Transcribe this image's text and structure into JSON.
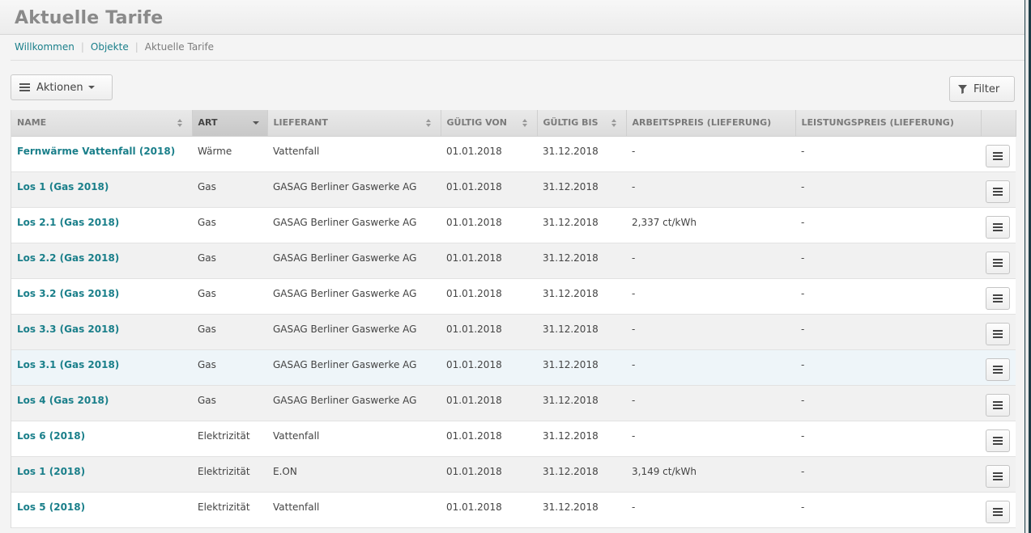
{
  "header": {
    "title": "Aktuelle Tarife"
  },
  "breadcrumb": {
    "items": [
      {
        "label": "Willkommen"
      },
      {
        "label": "Objekte"
      },
      {
        "label": "Aktuelle Tarife"
      }
    ]
  },
  "toolbar": {
    "actions_label": "Aktionen",
    "filter_label": "Filter"
  },
  "table": {
    "columns": [
      {
        "label": "NAME"
      },
      {
        "label": "ART"
      },
      {
        "label": "LIEFERANT"
      },
      {
        "label": "GÜLTIG VON"
      },
      {
        "label": "GÜLTIG BIS"
      },
      {
        "label": "ARBEITSPREIS (LIEFERUNG)"
      },
      {
        "label": "LEISTUNGSPREIS (LIEFERUNG)"
      },
      {
        "label": ""
      }
    ],
    "rows": [
      {
        "name": "Fernwärme Vattenfall (2018)",
        "art": "Wärme",
        "lieferant": "Vattenfall",
        "von": "01.01.2018",
        "bis": "31.12.2018",
        "arbeitspreis": "-",
        "leistungspreis": "-"
      },
      {
        "name": "Los 1 (Gas 2018)",
        "art": "Gas",
        "lieferant": "GASAG Berliner Gaswerke AG",
        "von": "01.01.2018",
        "bis": "31.12.2018",
        "arbeitspreis": "-",
        "leistungspreis": "-"
      },
      {
        "name": "Los 2.1 (Gas 2018)",
        "art": "Gas",
        "lieferant": "GASAG Berliner Gaswerke AG",
        "von": "01.01.2018",
        "bis": "31.12.2018",
        "arbeitspreis": "2,337 ct/kWh",
        "leistungspreis": "-"
      },
      {
        "name": "Los 2.2 (Gas 2018)",
        "art": "Gas",
        "lieferant": "GASAG Berliner Gaswerke AG",
        "von": "01.01.2018",
        "bis": "31.12.2018",
        "arbeitspreis": "-",
        "leistungspreis": "-"
      },
      {
        "name": "Los 3.2 (Gas 2018)",
        "art": "Gas",
        "lieferant": "GASAG Berliner Gaswerke AG",
        "von": "01.01.2018",
        "bis": "31.12.2018",
        "arbeitspreis": "-",
        "leistungspreis": "-"
      },
      {
        "name": "Los 3.3 (Gas 2018)",
        "art": "Gas",
        "lieferant": "GASAG Berliner Gaswerke AG",
        "von": "01.01.2018",
        "bis": "31.12.2018",
        "arbeitspreis": "-",
        "leistungspreis": "-"
      },
      {
        "name": "Los 3.1 (Gas 2018)",
        "art": "Gas",
        "lieferant": "GASAG Berliner Gaswerke AG",
        "von": "01.01.2018",
        "bis": "31.12.2018",
        "arbeitspreis": "-",
        "leistungspreis": "-"
      },
      {
        "name": "Los 4 (Gas 2018)",
        "art": "Gas",
        "lieferant": "GASAG Berliner Gaswerke AG",
        "von": "01.01.2018",
        "bis": "31.12.2018",
        "arbeitspreis": "-",
        "leistungspreis": "-"
      },
      {
        "name": "Los 6 (2018)",
        "art": "Elektrizität",
        "lieferant": "Vattenfall",
        "von": "01.01.2018",
        "bis": "31.12.2018",
        "arbeitspreis": "-",
        "leistungspreis": "-"
      },
      {
        "name": "Los 1 (2018)",
        "art": "Elektrizität",
        "lieferant": "E.ON",
        "von": "01.01.2018",
        "bis": "31.12.2018",
        "arbeitspreis": "3,149 ct/kWh",
        "leistungspreis": "-"
      },
      {
        "name": "Los 5 (2018)",
        "art": "Elektrizität",
        "lieferant": "Vattenfall",
        "von": "01.01.2018",
        "bis": "31.12.2018",
        "arbeitspreis": "-",
        "leistungspreis": "-"
      }
    ]
  },
  "icons": {
    "menu": "hamburger-icon",
    "dropdown": "chevron-down-icon",
    "filter": "funnel-icon",
    "sort": "sort-icon",
    "row_menu": "row-menu-icon"
  },
  "colors": {
    "link": "#1a7f8a",
    "sidebar_edge": "#1b3b45",
    "highlight_row": "#eef5f9"
  }
}
